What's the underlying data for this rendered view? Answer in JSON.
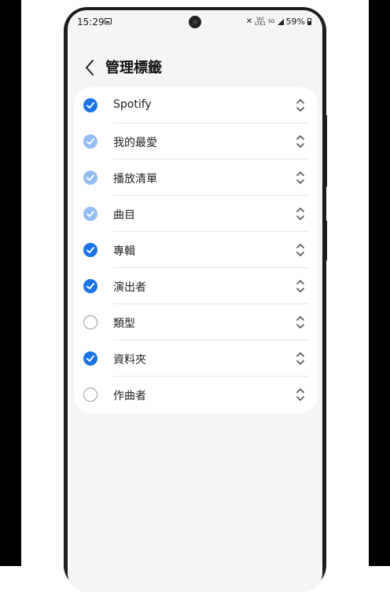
{
  "status_bar": {
    "time": "15:29",
    "lte_label": "Vo) LTE1",
    "net_label": "5G",
    "battery": "59%"
  },
  "header": {
    "title": "管理標籤"
  },
  "tabs": [
    {
      "label": "Spotify",
      "checked": true
    },
    {
      "label": "我的最愛",
      "checked": true
    },
    {
      "label": "播放清單",
      "checked": true
    },
    {
      "label": "曲目",
      "checked": true
    },
    {
      "label": "專輯",
      "checked": true
    },
    {
      "label": "演出者",
      "checked": true
    },
    {
      "label": "類型",
      "checked": false
    },
    {
      "label": "資料夾",
      "checked": true
    },
    {
      "label": "作曲者",
      "checked": false
    }
  ],
  "icons": {
    "back": "chevron-left-icon",
    "reorder": "drag-handle-icon",
    "check": "checkmark-icon"
  },
  "colors": {
    "accent": "#1a73e8",
    "accent_light": "#8fbdf3",
    "background": "#f5f5f5"
  }
}
